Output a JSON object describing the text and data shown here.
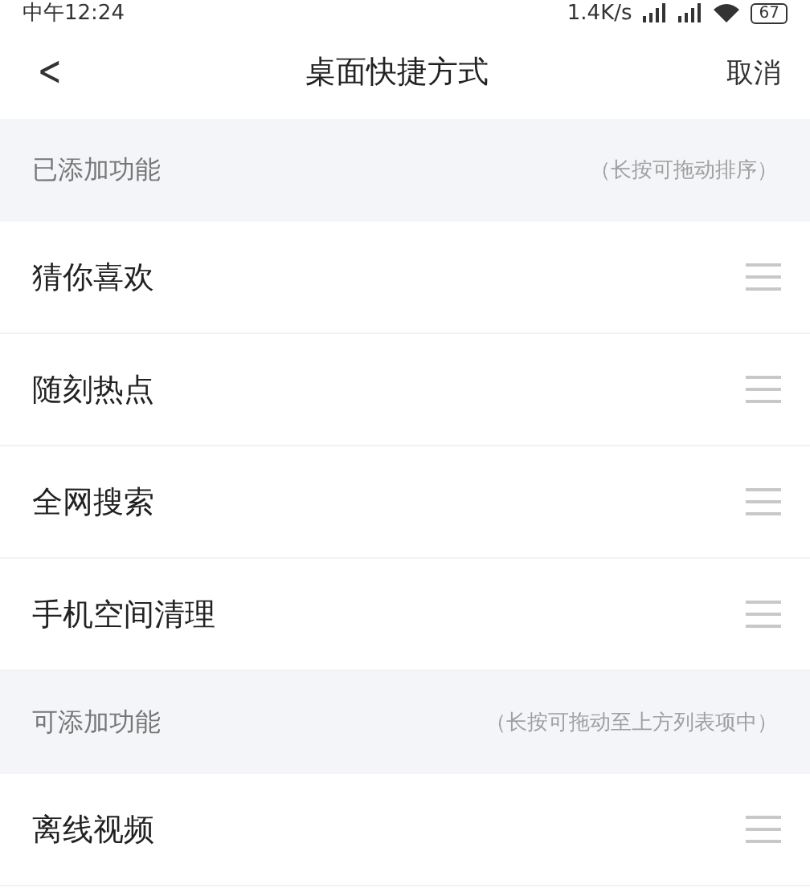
{
  "status_bar": {
    "time": "中午12:24",
    "speed": "1.4K/s",
    "battery": "67"
  },
  "header": {
    "back": "<",
    "title": "桌面快捷方式",
    "action": "取消"
  },
  "sections": [
    {
      "title": "已添加功能",
      "hint": "（长按可拖动排序）",
      "items": [
        {
          "label": "猜你喜欢"
        },
        {
          "label": "随刻热点"
        },
        {
          "label": "全网搜索"
        },
        {
          "label": "手机空间清理"
        }
      ]
    },
    {
      "title": "可添加功能",
      "hint": "（长按可拖动至上方列表项中）",
      "items": [
        {
          "label": "离线视频"
        }
      ]
    }
  ]
}
